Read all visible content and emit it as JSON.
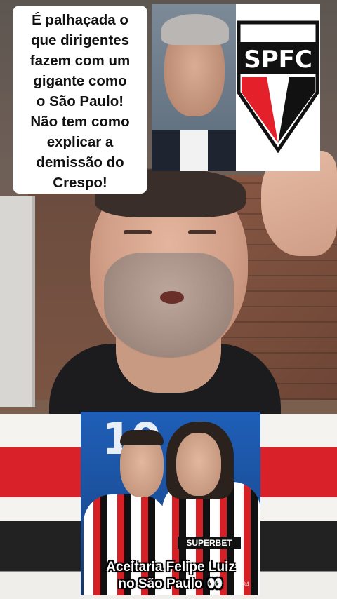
{
  "caption": {
    "lines": [
      "É palhaçada o",
      "que dirigentes",
      "fazem com um",
      "gigante como",
      "o São Paulo!",
      "Não tem como",
      "explicar a",
      "demissão do",
      "Crespo!"
    ]
  },
  "spfc": {
    "letters": "SPFC",
    "colors": {
      "red": "#e4202b",
      "black": "#111111",
      "white": "#ffffff"
    }
  },
  "players_photo": {
    "backdrop_text": "10",
    "sponsor_label": "SUPERBET",
    "caption_line1": "Aceitaria Felipe Luiz",
    "caption_line2": "no São Paulo 👀",
    "corner_number": "34"
  }
}
